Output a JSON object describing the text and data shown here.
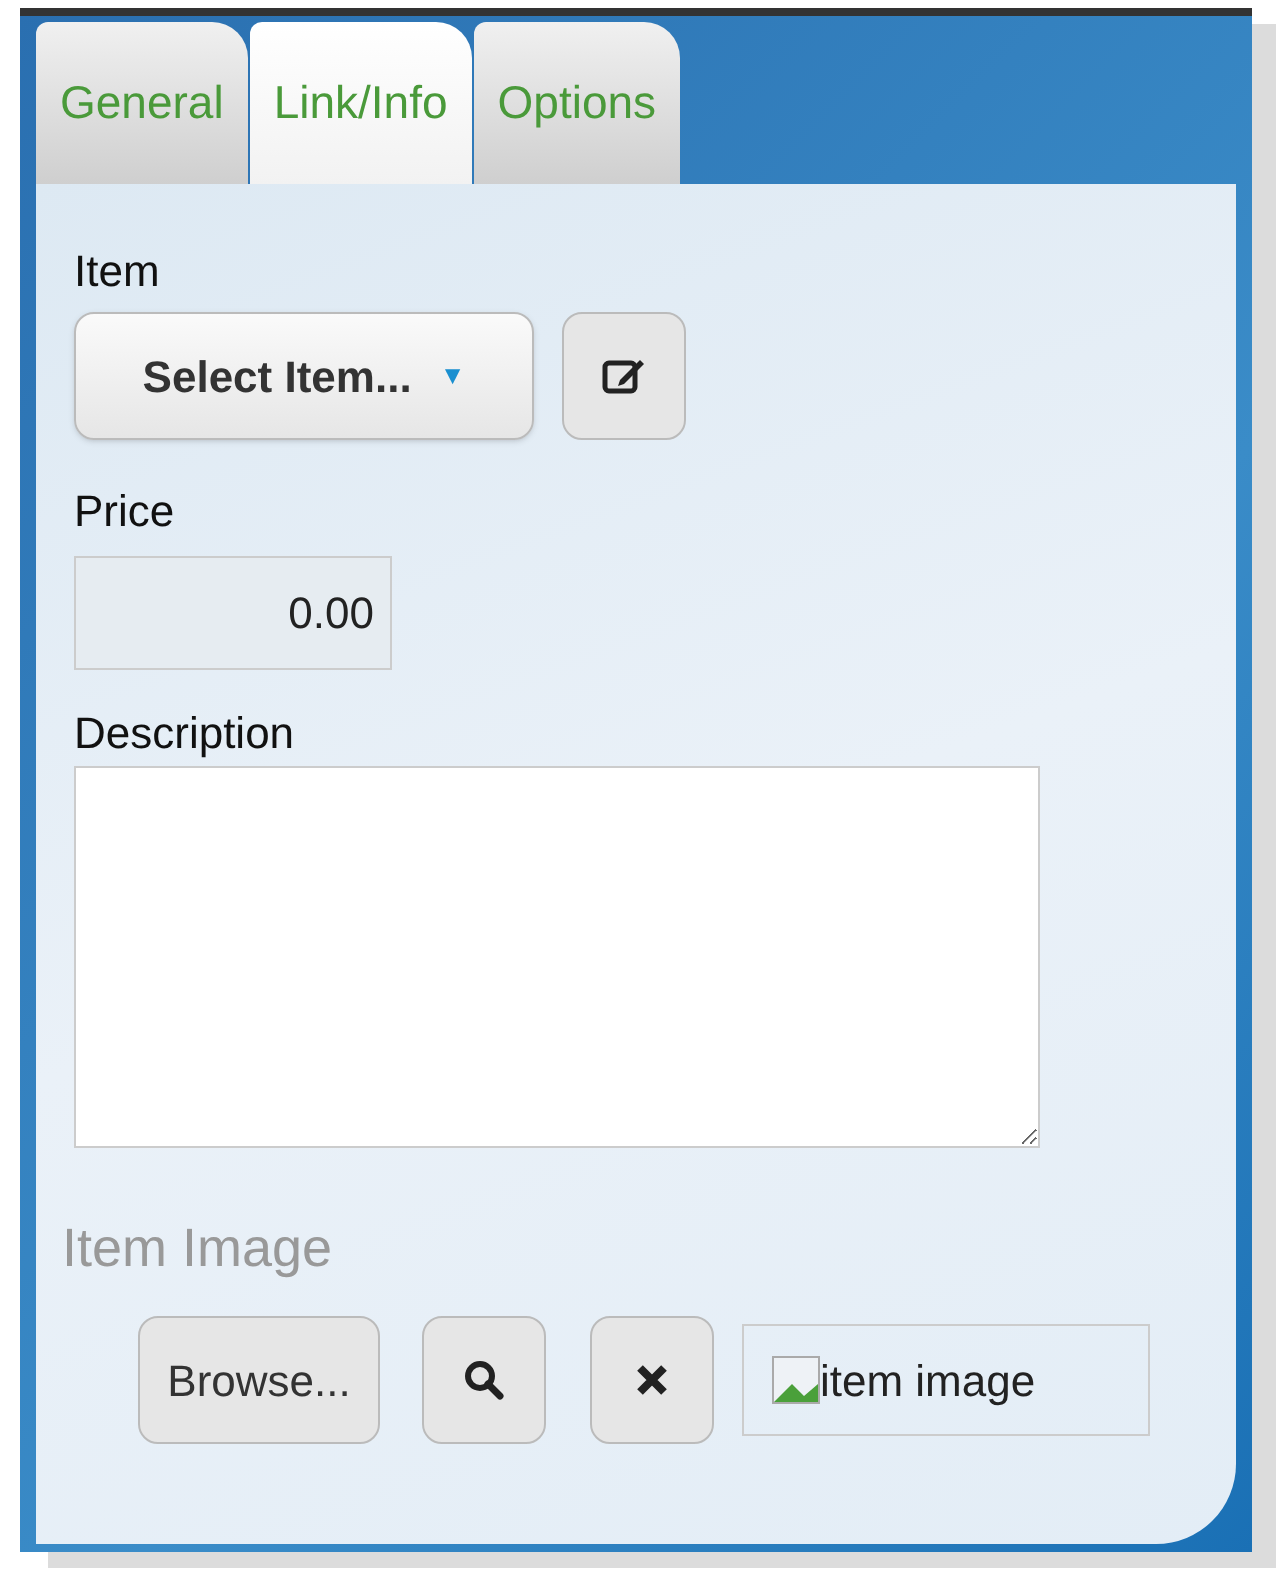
{
  "tabs": [
    {
      "label": "General",
      "selected": false
    },
    {
      "label": "Link/Info",
      "selected": true
    },
    {
      "label": "Options",
      "selected": false
    }
  ],
  "item": {
    "label": "Item",
    "select": "Select Item...",
    "caret": "▼"
  },
  "price": {
    "label": "Price",
    "value": "0.00"
  },
  "description": {
    "label": "Description"
  },
  "item_image": {
    "heading": "Item Image",
    "browse": "Browse...",
    "image_alt": "item image"
  }
}
